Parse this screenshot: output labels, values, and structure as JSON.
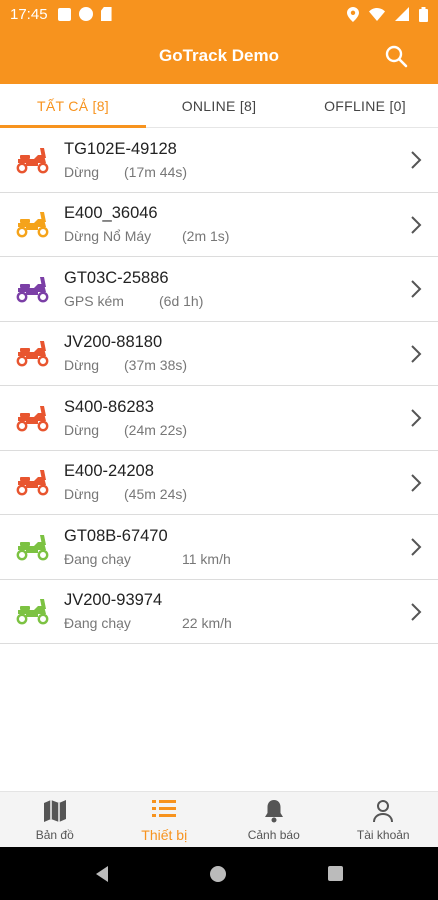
{
  "status_bar": {
    "time": "17:45"
  },
  "app_bar": {
    "title": "GoTrack Demo"
  },
  "tabs": [
    {
      "label": "TẤT CẢ [8]",
      "active": true
    },
    {
      "label": "ONLINE [8]",
      "active": false
    },
    {
      "label": "OFFLINE [0]",
      "active": false
    }
  ],
  "devices": [
    {
      "name": "TG102E-49128",
      "status": "Dừng",
      "detail": "(17m 44s)",
      "icon": "scooter-icon",
      "color": "#e8552f"
    },
    {
      "name": "E400_36046",
      "status": "Dừng Nổ Máy",
      "detail": "(2m 1s)",
      "icon": "scooter-icon",
      "color": "#f5a31a"
    },
    {
      "name": "GT03C-25886",
      "status": "GPS kém",
      "detail": "(6d 1h)",
      "icon": "scooter-icon",
      "color": "#7b3fa6"
    },
    {
      "name": "JV200-88180",
      "status": "Dừng",
      "detail": "(37m 38s)",
      "icon": "scooter-icon",
      "color": "#e8552f"
    },
    {
      "name": "S400-86283",
      "status": "Dừng",
      "detail": "(24m 22s)",
      "icon": "scooter-icon",
      "color": "#e8552f"
    },
    {
      "name": "E400-24208",
      "status": "Dừng",
      "detail": "(45m 24s)",
      "icon": "scooter-icon",
      "color": "#e8552f"
    },
    {
      "name": "GT08B-67470",
      "status": "Đang chạy",
      "detail": "11 km/h",
      "icon": "scooter-icon",
      "color": "#7cc242"
    },
    {
      "name": "JV200-93974",
      "status": "Đang chạy",
      "detail": "22 km/h",
      "icon": "scooter-icon",
      "color": "#7cc242"
    }
  ],
  "bottom_nav": [
    {
      "label": "Bản đồ",
      "icon": "map-icon",
      "active": false
    },
    {
      "label": "Thiết bị",
      "icon": "list-icon",
      "active": true
    },
    {
      "label": "Cảnh báo",
      "icon": "bell-icon",
      "active": false
    },
    {
      "label": "Tài khoản",
      "icon": "person-icon",
      "active": false
    }
  ],
  "colors": {
    "accent": "#f7931e"
  }
}
